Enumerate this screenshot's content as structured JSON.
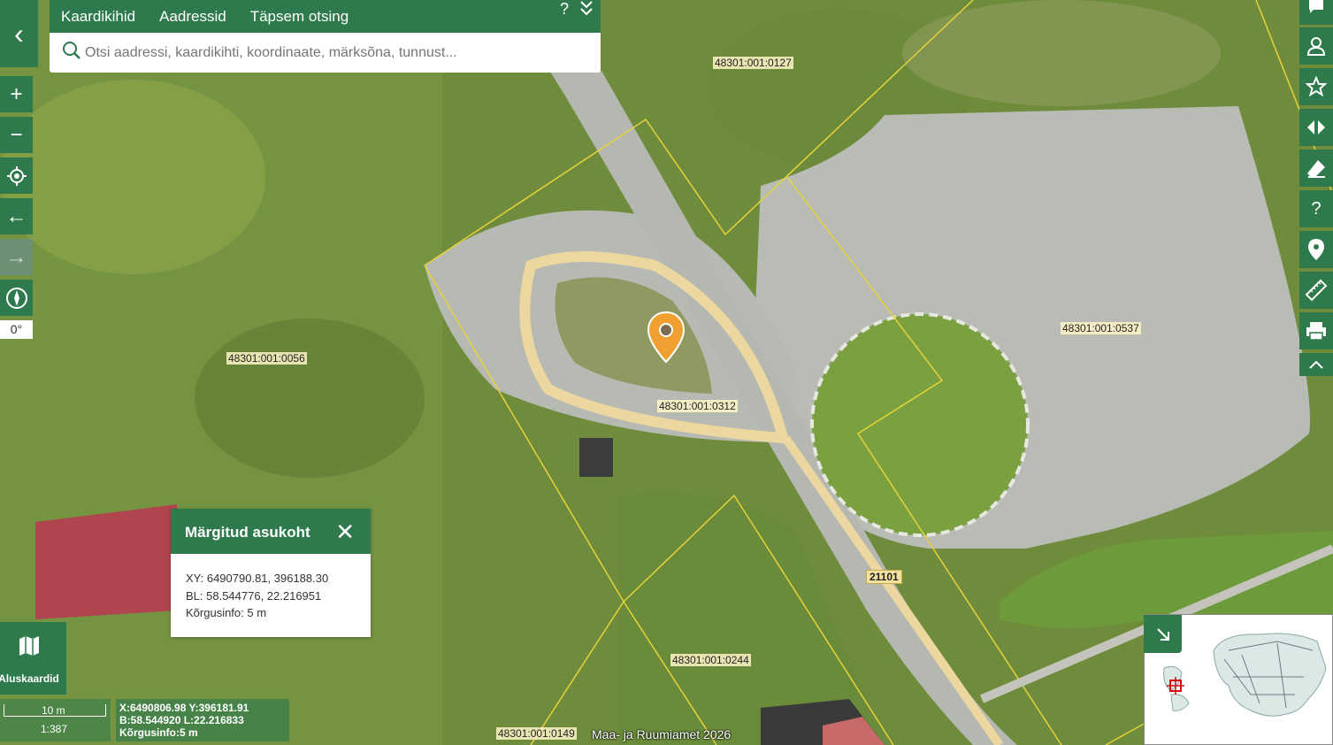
{
  "header": {
    "tabs": [
      "Kaardikihid",
      "Aadressid",
      "Täpsem otsing"
    ],
    "help_glyph": "?",
    "collapse_glyph": "⌄"
  },
  "search": {
    "placeholder": "Otsi aadressi, kaardikihti, koordinaate, märksõna, tunnust..."
  },
  "left_controls": {
    "back_glyph": "‹",
    "zoom_in": "+",
    "zoom_out": "−",
    "locate_icon": "locate-icon",
    "history_back": "←",
    "history_forward": "→",
    "compass_icon": "compass-icon",
    "rotation": "0°"
  },
  "right_toolbar": [
    {
      "name": "comment-icon"
    },
    {
      "name": "user-icon"
    },
    {
      "name": "star-icon"
    },
    {
      "name": "compare-icon"
    },
    {
      "name": "eraser-icon"
    },
    {
      "name": "help-icon",
      "glyph": "?"
    },
    {
      "name": "location-pin-icon"
    },
    {
      "name": "ruler-icon"
    },
    {
      "name": "print-icon"
    },
    {
      "name": "chevron-up-icon"
    }
  ],
  "map": {
    "parcels": [
      "48301:001:0127",
      "48301:001:0056",
      "48301:001:0312",
      "48301:001:0537",
      "48301:001:0244",
      "48301:001:0149"
    ],
    "road_number": "21101",
    "marker_color": "#f0a030"
  },
  "popup": {
    "title": "Märgitud asukoht",
    "xy": "XY: 6490790.81, 396188.30",
    "bl": "BL: 58.544776, 22.216951",
    "height": "Kõrgusinfo: 5 m"
  },
  "basemaps": {
    "label": "Aluskaardid"
  },
  "scale": {
    "distance": "10 m",
    "ratio": "1:387"
  },
  "cursor_coords": {
    "xy": "X:6490806.98 Y:396181.91",
    "bl": "B:58.544920 L:22.216833",
    "height": "Kõrgusinfo:5 m"
  },
  "attribution": "Maa- ja Ruumiamet 2026",
  "colors": {
    "brand_green": "#2e7a4c",
    "parcel_line": "#e6d23a",
    "road": "#f0d89a"
  }
}
